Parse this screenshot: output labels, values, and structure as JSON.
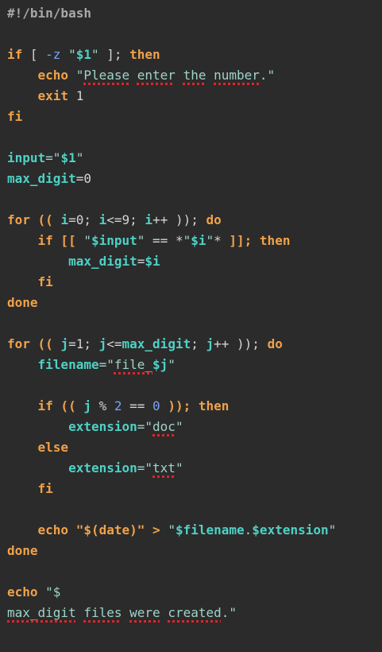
{
  "editor": {
    "lines": [
      [
        {
          "t": "#!/bin/bash",
          "c": "shebang"
        }
      ],
      [],
      [
        {
          "t": "if",
          "c": "kw"
        },
        {
          "t": " [ ",
          "c": "plain"
        },
        {
          "t": "-z",
          "c": "flag"
        },
        {
          "t": " \"",
          "c": "str"
        },
        {
          "t": "$1",
          "c": "var"
        },
        {
          "t": "\"",
          "c": "str"
        },
        {
          "t": " ]; ",
          "c": "plain"
        },
        {
          "t": "then",
          "c": "kw"
        }
      ],
      [
        {
          "t": "    ",
          "c": "plain"
        },
        {
          "t": "echo",
          "c": "kw"
        },
        {
          "t": " \"",
          "c": "str"
        },
        {
          "t": "Please",
          "c": "str",
          "s": true
        },
        {
          "t": " ",
          "c": "str"
        },
        {
          "t": "enter",
          "c": "str",
          "s": true
        },
        {
          "t": " ",
          "c": "str"
        },
        {
          "t": "the",
          "c": "str",
          "s": true
        },
        {
          "t": " ",
          "c": "str"
        },
        {
          "t": "number",
          "c": "str",
          "s": true
        },
        {
          "t": ".\"",
          "c": "str"
        }
      ],
      [
        {
          "t": "    ",
          "c": "plain"
        },
        {
          "t": "exit",
          "c": "kw"
        },
        {
          "t": " 1",
          "c": "num"
        }
      ],
      [
        {
          "t": "fi",
          "c": "kw"
        }
      ],
      [],
      [
        {
          "t": "input",
          "c": "var"
        },
        {
          "t": "=\"",
          "c": "str"
        },
        {
          "t": "$1",
          "c": "var"
        },
        {
          "t": "\"",
          "c": "str"
        }
      ],
      [
        {
          "t": "max_digit",
          "c": "var"
        },
        {
          "t": "=0",
          "c": "plain"
        }
      ],
      [],
      [
        {
          "t": "for",
          "c": "kw"
        },
        {
          "t": " (( ",
          "c": "kw"
        },
        {
          "t": "i",
          "c": "var"
        },
        {
          "t": "=0; ",
          "c": "plain"
        },
        {
          "t": "i",
          "c": "var"
        },
        {
          "t": "<=9; ",
          "c": "plain"
        },
        {
          "t": "i",
          "c": "var"
        },
        {
          "t": "++ )); ",
          "c": "plain"
        },
        {
          "t": "do",
          "c": "kw"
        }
      ],
      [
        {
          "t": "    ",
          "c": "plain"
        },
        {
          "t": "if",
          "c": "kw"
        },
        {
          "t": " [[ ",
          "c": "kw"
        },
        {
          "t": "\"",
          "c": "str"
        },
        {
          "t": "$input",
          "c": "var"
        },
        {
          "t": "\"",
          "c": "str"
        },
        {
          "t": " == *",
          "c": "plain"
        },
        {
          "t": "\"",
          "c": "str"
        },
        {
          "t": "$i",
          "c": "var"
        },
        {
          "t": "\"",
          "c": "str"
        },
        {
          "t": "* ",
          "c": "plain"
        },
        {
          "t": "]]; ",
          "c": "kw"
        },
        {
          "t": "then",
          "c": "kw"
        }
      ],
      [
        {
          "t": "        ",
          "c": "plain"
        },
        {
          "t": "max_digit",
          "c": "var"
        },
        {
          "t": "=",
          "c": "plain"
        },
        {
          "t": "$i",
          "c": "var"
        }
      ],
      [
        {
          "t": "    ",
          "c": "plain"
        },
        {
          "t": "fi",
          "c": "kw"
        }
      ],
      [
        {
          "t": "done",
          "c": "kw"
        }
      ],
      [],
      [
        {
          "t": "for",
          "c": "kw"
        },
        {
          "t": " (( ",
          "c": "kw"
        },
        {
          "t": "j",
          "c": "var"
        },
        {
          "t": "=1; ",
          "c": "plain"
        },
        {
          "t": "j",
          "c": "var"
        },
        {
          "t": "<=",
          "c": "plain"
        },
        {
          "t": "max_digit",
          "c": "var"
        },
        {
          "t": "; ",
          "c": "plain"
        },
        {
          "t": "j",
          "c": "var"
        },
        {
          "t": "++ )); ",
          "c": "plain"
        },
        {
          "t": "do",
          "c": "kw"
        }
      ],
      [
        {
          "t": "    ",
          "c": "plain"
        },
        {
          "t": "filename",
          "c": "var"
        },
        {
          "t": "=\"",
          "c": "str"
        },
        {
          "t": "file_",
          "c": "str",
          "s": true
        },
        {
          "t": "$j",
          "c": "var"
        },
        {
          "t": "\"",
          "c": "str"
        }
      ],
      [],
      [
        {
          "t": "    ",
          "c": "plain"
        },
        {
          "t": "if",
          "c": "kw"
        },
        {
          "t": " (( ",
          "c": "kw"
        },
        {
          "t": "j",
          "c": "var"
        },
        {
          "t": " % ",
          "c": "plain"
        },
        {
          "t": "2",
          "c": "flag"
        },
        {
          "t": " == ",
          "c": "plain"
        },
        {
          "t": "0",
          "c": "flag"
        },
        {
          "t": " )); ",
          "c": "kw"
        },
        {
          "t": "then",
          "c": "kw"
        }
      ],
      [
        {
          "t": "        ",
          "c": "plain"
        },
        {
          "t": "extension",
          "c": "var"
        },
        {
          "t": "=\"",
          "c": "str"
        },
        {
          "t": "doc",
          "c": "str",
          "s": true
        },
        {
          "t": "\"",
          "c": "str"
        }
      ],
      [
        {
          "t": "    ",
          "c": "plain"
        },
        {
          "t": "else",
          "c": "kw"
        }
      ],
      [
        {
          "t": "        ",
          "c": "plain"
        },
        {
          "t": "extension",
          "c": "var"
        },
        {
          "t": "=\"",
          "c": "str"
        },
        {
          "t": "txt",
          "c": "str",
          "s": true
        },
        {
          "t": "\"",
          "c": "str"
        }
      ],
      [
        {
          "t": "    ",
          "c": "plain"
        },
        {
          "t": "fi",
          "c": "kw"
        }
      ],
      [],
      [
        {
          "t": "    ",
          "c": "plain"
        },
        {
          "t": "echo",
          "c": "kw"
        },
        {
          "t": " \"",
          "c": "kw"
        },
        {
          "t": "$(date)",
          "c": "kw"
        },
        {
          "t": "\"",
          "c": "kw"
        },
        {
          "t": " > ",
          "c": "kw"
        },
        {
          "t": "\"",
          "c": "str"
        },
        {
          "t": "$filename",
          "c": "var"
        },
        {
          "t": ".",
          "c": "str"
        },
        {
          "t": "$extension",
          "c": "var"
        },
        {
          "t": "\"",
          "c": "str"
        }
      ],
      [
        {
          "t": "done",
          "c": "kw"
        }
      ],
      [],
      [
        {
          "t": "echo",
          "c": "kw"
        },
        {
          "t": " \"$",
          "c": "str"
        }
      ],
      [
        {
          "t": "max_digit",
          "c": "str",
          "s": true
        },
        {
          "t": " ",
          "c": "str"
        },
        {
          "t": "files",
          "c": "str",
          "s": true
        },
        {
          "t": " ",
          "c": "str"
        },
        {
          "t": "were",
          "c": "str",
          "s": true
        },
        {
          "t": " ",
          "c": "str"
        },
        {
          "t": "created",
          "c": "str",
          "s": true
        },
        {
          "t": ".\"",
          "c": "str"
        }
      ]
    ]
  },
  "colors": {
    "background": "#2b2b2b",
    "keyword": "#f0a24a",
    "string": "#9fd3c7",
    "variable": "#4fd1c5",
    "spellcheck": "#e0242a"
  }
}
